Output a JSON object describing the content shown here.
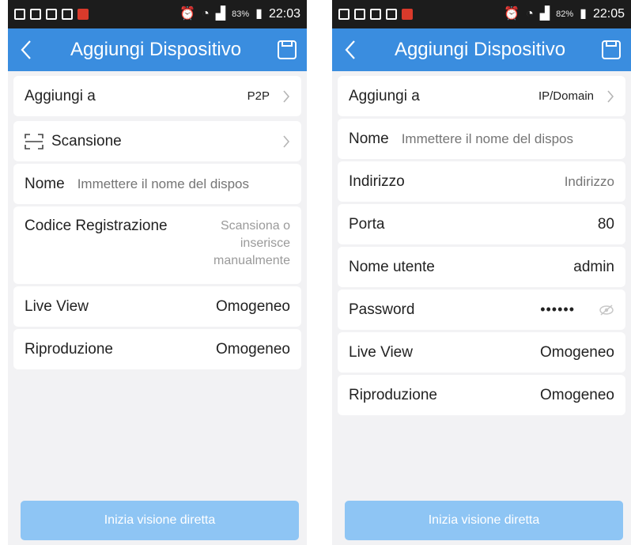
{
  "left": {
    "status": {
      "battery": "83%",
      "time": "22:03"
    },
    "title": "Aggiungi Dispositivo",
    "add_to": {
      "label": "Aggiungi a",
      "value": "P2P"
    },
    "scan": {
      "label": "Scansione"
    },
    "name": {
      "label": "Nome",
      "placeholder": "Immettere il nome del dispos"
    },
    "reg_code": {
      "label": "Codice Registrazione",
      "line1": "Scansiona o",
      "line2": "inserisce",
      "line3": "manualmente"
    },
    "live_view": {
      "label": "Live View",
      "value": "Omogeneo"
    },
    "playback": {
      "label": "Riproduzione",
      "value": "Omogeneo"
    },
    "cta": "Inizia visione diretta"
  },
  "right": {
    "status": {
      "battery": "82%",
      "time": "22:05"
    },
    "title": "Aggiungi Dispositivo",
    "add_to": {
      "label": "Aggiungi a",
      "value": "IP/Domain"
    },
    "name": {
      "label": "Nome",
      "placeholder": "Immettere il nome del dispos"
    },
    "address": {
      "label": "Indirizzo",
      "placeholder": "Indirizzo"
    },
    "port": {
      "label": "Porta",
      "value": "80"
    },
    "username": {
      "label": "Nome utente",
      "value": "admin"
    },
    "password": {
      "label": "Password",
      "value": "••••••"
    },
    "live_view": {
      "label": "Live View",
      "value": "Omogeneo"
    },
    "playback": {
      "label": "Riproduzione",
      "value": "Omogeneo"
    },
    "cta": "Inizia visione diretta"
  },
  "icons": {
    "back": "chevron-left-icon",
    "save": "save-icon",
    "chevron": "chevron-right-icon",
    "scan": "scan-icon",
    "eye": "eye-off-icon"
  },
  "colors": {
    "titlebar": "#3a8ddf",
    "statusbar": "#1c1c1c",
    "background": "#f2f2f4",
    "cta": "#8ec5f4"
  }
}
